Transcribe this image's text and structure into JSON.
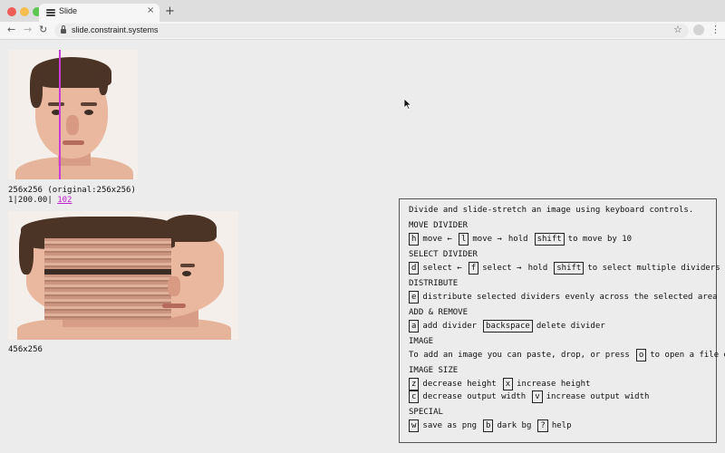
{
  "browser": {
    "tab_title": "Slide",
    "tab_close": "×",
    "new_tab": "+",
    "url": "slide.constraint.systems",
    "traffic_colors": [
      "#ee5e56",
      "#f4bd4f",
      "#5ec651"
    ]
  },
  "images": {
    "original_caption": "256x256 (original:256x256)",
    "status_prefix": "1|200.00|",
    "status_link": "102",
    "output_caption": "456x256",
    "divider_color": "#c93cd7"
  },
  "help": {
    "intro": "Divide and slide-stretch an image using keyboard controls.",
    "sections": {
      "move_divider": {
        "title": "MOVE DIVIDER",
        "h_key": "h",
        "h_text": "move ←",
        "l_key": "l",
        "l_text": "move →",
        "hold1": "hold",
        "shift_key": "shift",
        "shift_text": "to move by 10"
      },
      "select_divider": {
        "title": "SELECT DIVIDER",
        "d_key": "d",
        "d_text": "select ←",
        "f_key": "f",
        "f_text": "select →",
        "hold": "hold",
        "shift_key": "shift",
        "shift_text": "to select multiple dividers"
      },
      "distribute": {
        "title": "DISTRIBUTE",
        "e_key": "e",
        "e_text": "distribute selected dividers evenly across the selected area"
      },
      "add_remove": {
        "title": "ADD & REMOVE",
        "a_key": "a",
        "a_text": "add divider",
        "bs_key": "backspace",
        "bs_text": "delete divider"
      },
      "image": {
        "title": "IMAGE",
        "text_before": "To add an image you can paste, drop, or press",
        "o_key": "o",
        "text_after": "to open a file dialog."
      },
      "image_size": {
        "title": "IMAGE SIZE",
        "z_key": "z",
        "z_text": "decrease height",
        "x_key": "x",
        "x_text": "increase height",
        "c_key": "c",
        "c_text": "decrease output width",
        "v_key": "v",
        "v_text": "increase output width"
      },
      "special": {
        "title": "SPECIAL",
        "w_key": "w",
        "w_text": "save as png",
        "b_key": "b",
        "b_text": "dark bg",
        "q_key": "?",
        "q_text": "help"
      }
    }
  }
}
